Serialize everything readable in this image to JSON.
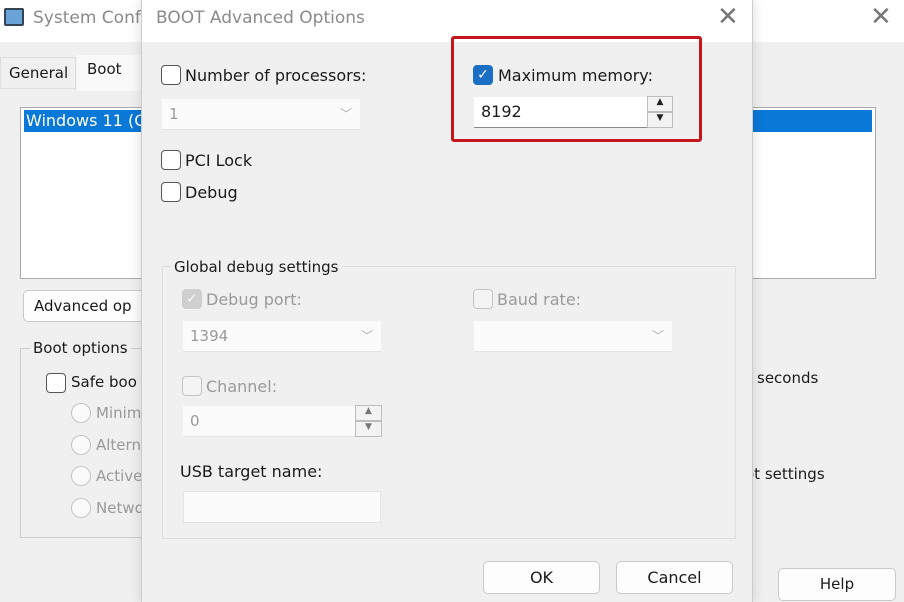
{
  "background_window": {
    "title": "System Conf",
    "tabs": [
      "General",
      "Boot"
    ],
    "boot_entry": "Windows 11 (C",
    "advanced_button": "Advanced op",
    "boot_options_label": "Boot options",
    "safe_boot": "Safe boo",
    "radios": [
      "Minima",
      "Altern",
      "Active",
      "Netwo"
    ],
    "seconds_label": "seconds",
    "boot_settings_label": "ot settings",
    "help_button": "Help"
  },
  "dialog": {
    "title": "BOOT Advanced Options",
    "num_processors": {
      "label": "Number of processors:",
      "checked": false,
      "value": "1"
    },
    "max_memory": {
      "label": "Maximum memory:",
      "checked": true,
      "value": "8192"
    },
    "pci_lock": {
      "label": "PCI Lock",
      "checked": false
    },
    "debug": {
      "label": "Debug",
      "checked": false
    },
    "global_debug": {
      "label": "Global debug settings",
      "debug_port": {
        "label": "Debug port:",
        "checked": true,
        "value": "1394"
      },
      "baud_rate": {
        "label": "Baud rate:",
        "checked": false,
        "value": ""
      },
      "channel": {
        "label": "Channel:",
        "checked": false,
        "value": "0"
      },
      "usb_target": {
        "label": "USB target name:",
        "value": ""
      }
    },
    "ok": "OK",
    "cancel": "Cancel"
  },
  "colors": {
    "highlight": "#c4161c",
    "accent": "#1a6fc4"
  }
}
